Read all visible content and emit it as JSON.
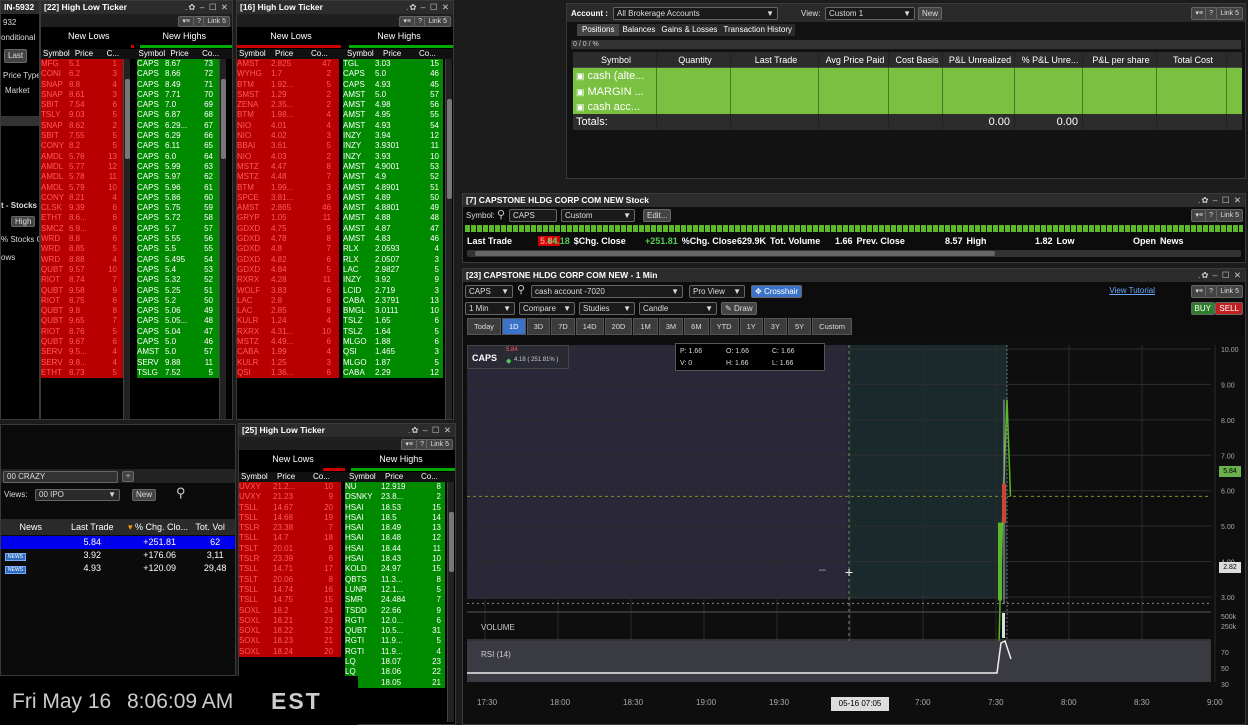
{
  "window_left": {
    "id_text": "IN-5932",
    "sub1": "932",
    "cond": "onditional",
    "last": "Last",
    "price_type": "Price Type",
    "market": "Market",
    "stocks": "t - Stocks",
    "high": "High",
    "stocks_c": "% Stocks C",
    "ows": "ows"
  },
  "ticker22": {
    "title": "[22] High Low Ticker",
    "link": "Link 5",
    "tab_lows": "New Lows",
    "tab_highs": "New Highs",
    "headers": [
      "Symbol",
      "Price",
      "C...",
      "Symbol",
      "Price",
      "Co...",
      ""
    ],
    "lows": [
      [
        "MFG",
        "5.1",
        "1"
      ],
      [
        "CONI",
        "6.2",
        "3"
      ],
      [
        "SNAP",
        "8.8",
        "4"
      ],
      [
        "SNAP",
        "8.61",
        "3"
      ],
      [
        "SBIT",
        "7.54",
        "6"
      ],
      [
        "TSLY",
        "9.03",
        "5"
      ],
      [
        "SNAP",
        "8.62",
        "2"
      ],
      [
        "SBIT",
        "7.55",
        "5"
      ],
      [
        "CONY",
        "8.2",
        "5"
      ],
      [
        "AMDL",
        "5.76",
        "13"
      ],
      [
        "AMDL",
        "5.77",
        "12"
      ],
      [
        "AMDL",
        "5.78",
        "11"
      ],
      [
        "AMDL",
        "5.79",
        "10"
      ],
      [
        "CONY",
        "8.21",
        "4"
      ],
      [
        "CLSK",
        "9.39",
        "6"
      ],
      [
        "ETHT",
        "8.6...",
        "6"
      ],
      [
        "SMCZ",
        "6.9...",
        "6"
      ],
      [
        "WRD",
        "8.8",
        "6"
      ],
      [
        "WRD",
        "8.85",
        "5"
      ],
      [
        "WRD",
        "8.88",
        "4"
      ],
      [
        "QUBT",
        "9.57",
        "10"
      ],
      [
        "RIOT",
        "8.74",
        "7"
      ],
      [
        "QUBT",
        "9.58",
        "9"
      ],
      [
        "RIOT",
        "8.75",
        "6"
      ],
      [
        "QUBT",
        "9.8",
        "8"
      ],
      [
        "QUBT",
        "9.65",
        "7"
      ],
      [
        "RIOT",
        "8.76",
        "5"
      ],
      [
        "QUBT",
        "9.67",
        "6"
      ],
      [
        "SERV",
        "9.5...",
        "4"
      ],
      [
        "SERV",
        "9.8...",
        "4"
      ],
      [
        "ETHT",
        "8.73",
        "5"
      ]
    ],
    "highs": [
      [
        "CAPS",
        "8.67",
        "73"
      ],
      [
        "CAPS",
        "8.66",
        "72"
      ],
      [
        "CAPS",
        "8.49",
        "71"
      ],
      [
        "CAPS",
        "7.71",
        "70"
      ],
      [
        "CAPS",
        "7.0",
        "69"
      ],
      [
        "CAPS",
        "6.87",
        "68"
      ],
      [
        "CAPS",
        "6.29...",
        "67"
      ],
      [
        "CAPS",
        "6.29",
        "66"
      ],
      [
        "CAPS",
        "6.11",
        "65"
      ],
      [
        "CAPS",
        "6.0",
        "64"
      ],
      [
        "CAPS",
        "5.99",
        "63"
      ],
      [
        "CAPS",
        "5.97",
        "62"
      ],
      [
        "CAPS",
        "5.96",
        "61"
      ],
      [
        "CAPS",
        "5.86",
        "60"
      ],
      [
        "CAPS",
        "5.75",
        "59"
      ],
      [
        "CAPS",
        "5.72",
        "58"
      ],
      [
        "CAPS",
        "5.7",
        "57"
      ],
      [
        "CAPS",
        "5.55",
        "56"
      ],
      [
        "CAPS",
        "5.5",
        "55"
      ],
      [
        "CAPS",
        "5.495",
        "54"
      ],
      [
        "CAPS",
        "5.4",
        "53"
      ],
      [
        "CAPS",
        "5.32",
        "52"
      ],
      [
        "CAPS",
        "5.25",
        "51"
      ],
      [
        "CAPS",
        "5.2",
        "50"
      ],
      [
        "CAPS",
        "5.06",
        "49"
      ],
      [
        "CAPS",
        "5.05...",
        "48"
      ],
      [
        "CAPS",
        "5.04",
        "47"
      ],
      [
        "CAPS",
        "5.0",
        "46"
      ],
      [
        "AMST",
        "5.0",
        "57"
      ],
      [
        "SERV",
        "9.88",
        "11"
      ],
      [
        "TSLG",
        "7.52",
        "5"
      ]
    ]
  },
  "ticker16": {
    "title": "[16] High Low Ticker",
    "link": "Link 5",
    "tab_lows": "New Lows",
    "tab_highs": "New Highs",
    "headers": [
      "Symbol",
      "Price",
      "Co...",
      "Symbol",
      "Price",
      "Co..."
    ],
    "lows": [
      [
        "AMST",
        "2.825",
        "47"
      ],
      [
        "WYHG",
        "1.7",
        "2"
      ],
      [
        "BTM",
        "1.92...",
        "5"
      ],
      [
        "SMST",
        "1.29",
        "2"
      ],
      [
        "ZENA",
        "2.35...",
        "2"
      ],
      [
        "BTM",
        "1.98...",
        "4"
      ],
      [
        "NIO",
        "4.01",
        "4"
      ],
      [
        "NIO",
        "4.02",
        "3"
      ],
      [
        "BBAI",
        "3.61",
        "5"
      ],
      [
        "NIO",
        "4.03",
        "2"
      ],
      [
        "MSTZ",
        "4.47",
        "8"
      ],
      [
        "MSTZ",
        "4.48",
        "7"
      ],
      [
        "BTM",
        "1.99...",
        "3"
      ],
      [
        "SPCE",
        "3.81...",
        "9"
      ],
      [
        "AMST",
        "2.865",
        "46"
      ],
      [
        "GRYP",
        "1.05",
        "11"
      ],
      [
        "GDXD",
        "4.75",
        "9"
      ],
      [
        "GDXD",
        "4.78",
        "8"
      ],
      [
        "GDXD",
        "4.8",
        "7"
      ],
      [
        "GDXD",
        "4.82",
        "6"
      ],
      [
        "GDXD",
        "4.84",
        "5"
      ],
      [
        "RXRX",
        "4.28",
        "11"
      ],
      [
        "WOLF",
        "3.83",
        "6"
      ],
      [
        "LAC",
        "2.8",
        "8"
      ],
      [
        "LAC",
        "2.85",
        "8"
      ],
      [
        "KULR",
        "1.24",
        "4"
      ],
      [
        "RXRX",
        "4.31...",
        "10"
      ],
      [
        "MSTZ",
        "4.49...",
        "6"
      ],
      [
        "CABA",
        "1.99",
        "4"
      ],
      [
        "KULR",
        "1.25",
        "3"
      ],
      [
        "QSI",
        "1.36...",
        "6"
      ]
    ],
    "highs": [
      [
        "TGL",
        "3.03",
        "15"
      ],
      [
        "CAPS",
        "5.0",
        "46"
      ],
      [
        "CAPS",
        "4.93",
        "45"
      ],
      [
        "AMST",
        "5.0",
        "57"
      ],
      [
        "AMST",
        "4.98",
        "56"
      ],
      [
        "AMST",
        "4.95",
        "55"
      ],
      [
        "AMST",
        "4.93",
        "54"
      ],
      [
        "INZY",
        "3.94",
        "12"
      ],
      [
        "INZY",
        "3.9301",
        "11"
      ],
      [
        "INZY",
        "3.93",
        "10"
      ],
      [
        "AMST",
        "4.9001",
        "53"
      ],
      [
        "AMST",
        "4.9",
        "52"
      ],
      [
        "AMST",
        "4.8901",
        "51"
      ],
      [
        "AMST",
        "4.89",
        "50"
      ],
      [
        "AMST",
        "4.8801",
        "49"
      ],
      [
        "AMST",
        "4.88",
        "48"
      ],
      [
        "AMST",
        "4.87",
        "47"
      ],
      [
        "AMST",
        "4.83",
        "46"
      ],
      [
        "RLX",
        "2.0593",
        "4"
      ],
      [
        "RLX",
        "2.0507",
        "3"
      ],
      [
        "LAC",
        "2.9827",
        "5"
      ],
      [
        "INZY",
        "3.92",
        "9"
      ],
      [
        "LCID",
        "2.719",
        "3"
      ],
      [
        "CABA",
        "2.3791",
        "13"
      ],
      [
        "BMGL",
        "3.0111",
        "10"
      ],
      [
        "TSLZ",
        "1.65",
        "6"
      ],
      [
        "TSLZ",
        "1.64",
        "5"
      ],
      [
        "MLGO",
        "1.88",
        "6"
      ],
      [
        "QSI",
        "1.465",
        "3"
      ],
      [
        "MLGO",
        "1.87",
        "5"
      ],
      [
        "CABA",
        "2.29",
        "12"
      ]
    ]
  },
  "ticker25": {
    "title": "[25] High Low Ticker",
    "link": "Link 5",
    "tab_lows": "New Lows",
    "tab_highs": "New Highs",
    "headers": [
      "Symbol",
      "Price",
      "Co...",
      "Symbol",
      "Price",
      "Co..."
    ],
    "lows": [
      [
        "UVXY",
        "21.2...",
        "10"
      ],
      [
        "UVXY",
        "21.23",
        "9"
      ],
      [
        "TSLL",
        "14.67",
        "20"
      ],
      [
        "TSLL",
        "14.68",
        "19"
      ],
      [
        "TSLR",
        "23.38",
        "7"
      ],
      [
        "TSLL",
        "14.7",
        "18"
      ],
      [
        "TSLT",
        "20.01",
        "9"
      ],
      [
        "TSLR",
        "23.39",
        "6"
      ],
      [
        "TSLL",
        "14.71",
        "17"
      ],
      [
        "TSLT",
        "20.06",
        "8"
      ],
      [
        "TSLL",
        "14.74",
        "16"
      ],
      [
        "TSLL",
        "14.75",
        "15"
      ],
      [
        "SOXL",
        "18.2",
        "24"
      ],
      [
        "SOXL",
        "18.21",
        "23"
      ],
      [
        "SOXL",
        "18.22",
        "22"
      ],
      [
        "SOXL",
        "18.23",
        "21"
      ],
      [
        "SOXL",
        "18.24",
        "20"
      ]
    ],
    "highs": [
      [
        "NU",
        "12.919",
        "8"
      ],
      [
        "DSNKY",
        "23.8...",
        "2"
      ],
      [
        "HSAI",
        "18.53",
        "15"
      ],
      [
        "HSAI",
        "18.5",
        "14"
      ],
      [
        "HSAI",
        "18.49",
        "13"
      ],
      [
        "HSAI",
        "18.48",
        "12"
      ],
      [
        "HSAI",
        "18.44",
        "11"
      ],
      [
        "HSAI",
        "18.43",
        "10"
      ],
      [
        "KOLD",
        "24.97",
        "15"
      ],
      [
        "QBTS",
        "11.3...",
        "8"
      ],
      [
        "LUNR",
        "12.1...",
        "5"
      ],
      [
        "SMR",
        "24.484",
        "7"
      ],
      [
        "TSDD",
        "22.66",
        "9"
      ],
      [
        "RGTI",
        "12.0...",
        "6"
      ],
      [
        "QUBT",
        "10.5...",
        "31"
      ],
      [
        "RGTI",
        "11.9...",
        "5"
      ],
      [
        "RGTI",
        "11.9...",
        "4"
      ],
      [
        "LQ",
        "18.07",
        "23"
      ],
      [
        "LQ",
        "18.06",
        "22"
      ],
      [
        "LQ",
        "18.05",
        "21"
      ]
    ]
  },
  "watchlist": {
    "tab": "00 CRAZY",
    "views_label": "Views:",
    "views_value": "00 IPO",
    "new_btn": "New",
    "headers": [
      "News",
      "Last Trade",
      "% Chg. Clo...",
      "Tot. Vol"
    ],
    "rows": [
      [
        "",
        "5.84",
        "+251.81",
        "62"
      ],
      [
        "NEWS",
        "3.92",
        "+176.06",
        "3,11"
      ],
      [
        "NEWS",
        "4.93",
        "+120.09",
        "29,48"
      ]
    ]
  },
  "clock": {
    "date": "Fri May 16",
    "time": "8:06:09 AM",
    "tz": "EST"
  },
  "account": {
    "label": "Account :",
    "value": "All Brokerage Accounts",
    "view_label": "View:",
    "view_value": "Custom 1",
    "new_btn": "New",
    "link": "Link 5",
    "tabs": [
      "Positions",
      "Balances",
      "Gains & Losses",
      "Transaction History"
    ],
    "headers": [
      "Symbol",
      "Quantity",
      "Last Trade",
      "Avg Price Paid",
      "Cost Basis",
      "P&L Unrealized",
      "% P&L Unre...",
      "P&L per share",
      "Total Cost"
    ],
    "rows": [
      "cash (alte...",
      "MARGIN ...",
      "cash acc..."
    ],
    "totals_label": "Totals:",
    "totals_pl": "0.00",
    "totals_pct": "0.00"
  },
  "stock7": {
    "title": "[7] CAPSTONE HLDG CORP COM NEW Stock",
    "symbol_label": "Symbol:",
    "symbol": "CAPS",
    "custom": "Custom",
    "edit": "Edit...",
    "link": "Link 5",
    "quote": [
      [
        "Last Trade",
        "5.84"
      ],
      [
        "$Chg. Close",
        "+4.18"
      ],
      [
        "%Chg. Close",
        "+251.81"
      ],
      [
        "Tot. Volume",
        "629.9K"
      ],
      [
        "Prev. Close",
        "1.66"
      ],
      [
        "High",
        "8.57"
      ],
      [
        "Low",
        "1.82"
      ],
      [
        "News",
        "Open"
      ]
    ]
  },
  "chart23": {
    "title": "[23] CAPSTONE HLDG CORP COM NEW - 1 Min",
    "symbol": "CAPS",
    "account": "cash account -7020",
    "pro_view": "Pro View",
    "crosshair": "Crosshair",
    "view_tutorial": "View Tutorial",
    "link": "Link 5",
    "interval": "1 Min",
    "compare": "Compare",
    "studies": "Studies",
    "candle": "Candle",
    "draw": "Draw",
    "buy": "BUY",
    "sell": "SELL",
    "ranges": [
      "Today",
      "1D",
      "3D",
      "7D",
      "14D",
      "20D",
      "1M",
      "3M",
      "6M",
      "YTD",
      "1Y",
      "3Y",
      "5Y",
      "Custom"
    ],
    "legend_symbol": "CAPS",
    "legend_price": "5.84",
    "legend_change": "4.18 ( 251.81% )",
    "ohlc": {
      "p": "P: 1.66",
      "o": "O: 1.66",
      "c": "C: 1.66",
      "v": "V: 0",
      "h": "H: 1.66",
      "l": "L: 1.66"
    },
    "price_marker": "5.84",
    "cross_marker": "2.82",
    "volume_label": "VOLUME",
    "rsi_label": "RSI (14)",
    "x_cursor_label": "05-16 07:05"
  },
  "chart_data": {
    "type": "line",
    "title": "",
    "xlabel": "",
    "ylabel": "",
    "x_ticks": [
      "17:30",
      "18:00",
      "18:30",
      "19:00",
      "19:30",
      "20:00",
      "7:00",
      "7:30",
      "8:00",
      "8:30",
      "9:00"
    ],
    "y_ticks": [
      "10.00",
      "9.00",
      "8.00",
      "7.00",
      "6.00",
      "5.00",
      "4.00",
      "3.00"
    ],
    "volume_ticks": [
      "500k",
      "250k"
    ],
    "rsi_ticks": [
      "70",
      "50",
      "30"
    ],
    "series": [
      {
        "values": [
          1.66,
          1.66,
          1.66,
          1.66,
          1.66,
          1.66,
          1.66,
          1.66,
          2.8,
          6.0,
          8.57,
          5.84
        ]
      }
    ]
  },
  "colors": {
    "red": "#b80000",
    "green": "#008a00",
    "accent": "#3a73c9",
    "account_green": "#7ac142"
  }
}
